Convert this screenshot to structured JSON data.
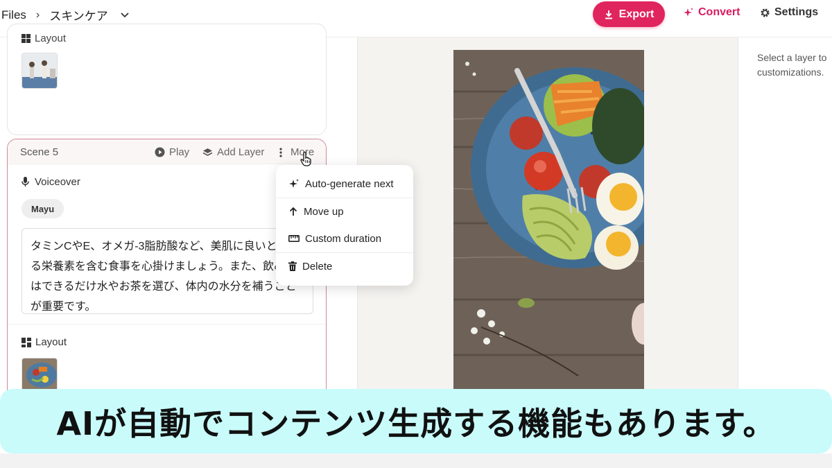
{
  "header": {
    "breadcrumb_root": "Files",
    "breadcrumb_sep": "›",
    "breadcrumb_project": "スキンケア",
    "export_label": "Export",
    "convert_label": "Convert",
    "settings_label": "Settings"
  },
  "left": {
    "prev_layout_label": "Layout",
    "scene": {
      "title": "Scene 5",
      "play_label": "Play",
      "add_layer_label": "Add Layer",
      "more_label": "More",
      "voiceover_label": "Voiceover",
      "voice_name": "Mayu",
      "text": "タミンCやE、オメガ-3脂肪酸など、美肌に良いとされる栄養素を含む食事を心掛けましょう。また、飲み物はできるだけ水やお茶を選び、体内の水分を補うことが重要です。",
      "layout_label": "Layout"
    }
  },
  "menu": {
    "items": [
      {
        "label": "Auto-generate next",
        "icon": "sparkle-icon"
      },
      {
        "label": "Move up",
        "icon": "arrow-up-icon"
      },
      {
        "label": "Custom duration",
        "icon": "ruler-icon"
      },
      {
        "label": "Delete",
        "icon": "trash-icon"
      }
    ]
  },
  "right": {
    "hint_line1": "Select a layer to",
    "hint_line2": "customizations."
  },
  "caption": "AIが自動でコンテンツ生成する機能もあります。",
  "colors": {
    "accent": "#e0245e",
    "convert": "#d81b60",
    "caption_bg": "#c9fbfb",
    "scene_border": "#c98a98"
  }
}
